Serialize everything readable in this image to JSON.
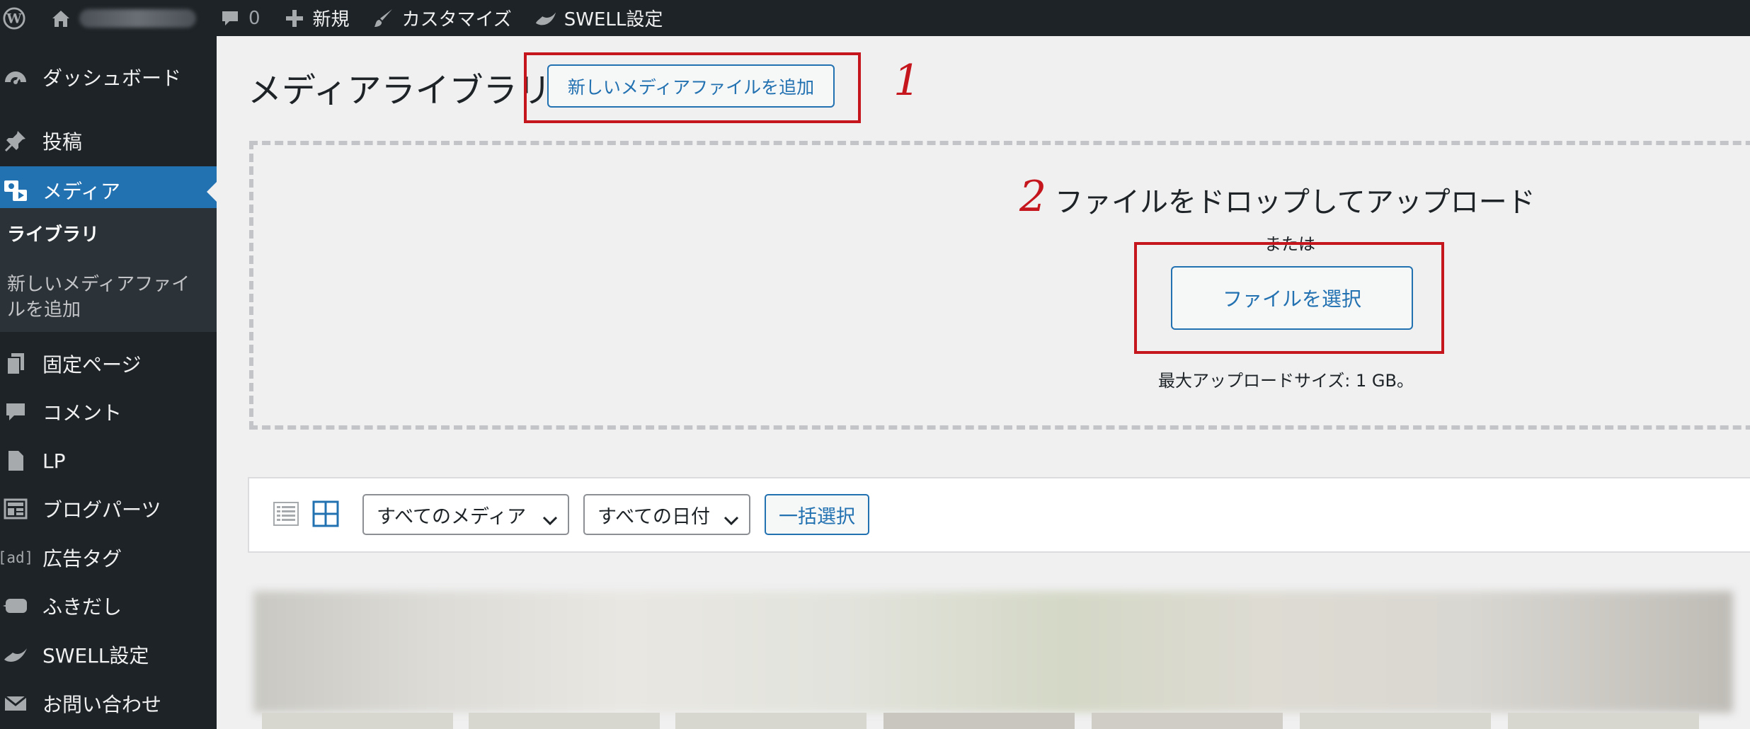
{
  "adminbar": {
    "comment_count": "0",
    "new_label": "新規",
    "customize_label": "カスタマイズ",
    "swell_label": "SWELL設定"
  },
  "sidebar": {
    "items": [
      {
        "label": "ダッシュボード",
        "icon": "dashboard-icon"
      },
      {
        "label": "投稿",
        "icon": "pin-icon"
      },
      {
        "label": "メディア",
        "icon": "media-icon"
      },
      {
        "label": "固定ページ",
        "icon": "pages-icon"
      },
      {
        "label": "コメント",
        "icon": "comment-icon"
      },
      {
        "label": "LP",
        "icon": "page-icon"
      },
      {
        "label": "ブログパーツ",
        "icon": "layout-icon"
      },
      {
        "label": "広告タグ",
        "icon": "ad-icon"
      },
      {
        "label": "ふきだし",
        "icon": "balloon-icon"
      },
      {
        "label": "SWELL設定",
        "icon": "swell-icon"
      },
      {
        "label": "お問い合わせ",
        "icon": "mail-icon"
      }
    ],
    "submenu": {
      "library": "ライブラリ",
      "add_new_line1": "新しいメディアファイ",
      "add_new_line2": "ルを追加"
    },
    "ad_icon_text": "[ad]"
  },
  "main": {
    "title": "メディアライブラリ",
    "add_new_button": "新しいメディアファイルを追加",
    "annotation_1": "1",
    "annotation_2": "2",
    "drop_instructions": "ファイルをドロップしてアップロード",
    "or_text": "または",
    "select_files_button": "ファイルを選択",
    "max_upload": "最大アップロードサイズ: 1 GB。"
  },
  "toolbar": {
    "filter_media": "すべてのメディア",
    "filter_dates": "すべての日付",
    "bulk_select": "一括選択"
  },
  "colors": {
    "accent": "#2271b1",
    "annotation": "#c5161d",
    "adminbar_bg": "#1d2327"
  }
}
